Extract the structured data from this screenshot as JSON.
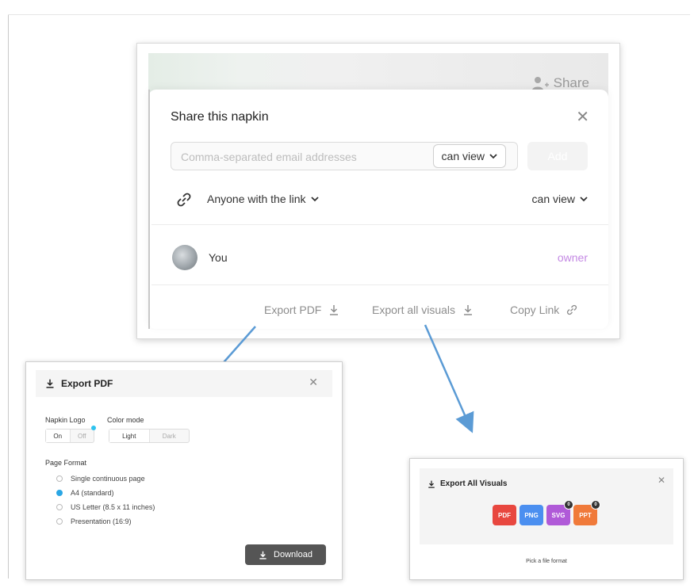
{
  "share_dialog": {
    "topbar_share_label": "Share",
    "title": "Share this napkin",
    "email_placeholder": "Comma-separated email addresses",
    "invite_permission": "can view",
    "add_label": "Add",
    "link_access_label": "Anyone with the link",
    "link_permission": "can view",
    "member": {
      "name": "You",
      "role": "owner"
    },
    "footer": {
      "export_pdf": "Export PDF",
      "export_all_visuals": "Export all visuals",
      "copy_link": "Copy Link"
    }
  },
  "export_pdf_panel": {
    "title": "Export PDF",
    "napkin_logo_label": "Napkin Logo",
    "logo_on": "On",
    "logo_off": "Off",
    "color_mode_label": "Color mode",
    "color_light": "Light",
    "color_dark": "Dark",
    "page_format_label": "Page Format",
    "page_formats": [
      {
        "label": "Single continuous page",
        "selected": false
      },
      {
        "label": "A4 (standard)",
        "selected": true
      },
      {
        "label": "US Letter (8.5 x 11 inches)",
        "selected": false
      },
      {
        "label": "Presentation (16:9)",
        "selected": false
      }
    ],
    "download_label": "Download"
  },
  "export_visuals_panel": {
    "title": "Export All Visuals",
    "formats": [
      {
        "label": "PDF",
        "color": "#e8473f",
        "badge": ""
      },
      {
        "label": "PNG",
        "color": "#4b8ff0",
        "badge": ""
      },
      {
        "label": "SVG",
        "color": "#b05ad8",
        "badge": "0"
      },
      {
        "label": "PPT",
        "color": "#f07a3a",
        "badge": "0"
      }
    ],
    "hint": "Pick a file format"
  },
  "colors": {
    "arrow": "#5b9bd5",
    "owner": "#c489e4",
    "radio_selected": "#2aa6e4"
  }
}
